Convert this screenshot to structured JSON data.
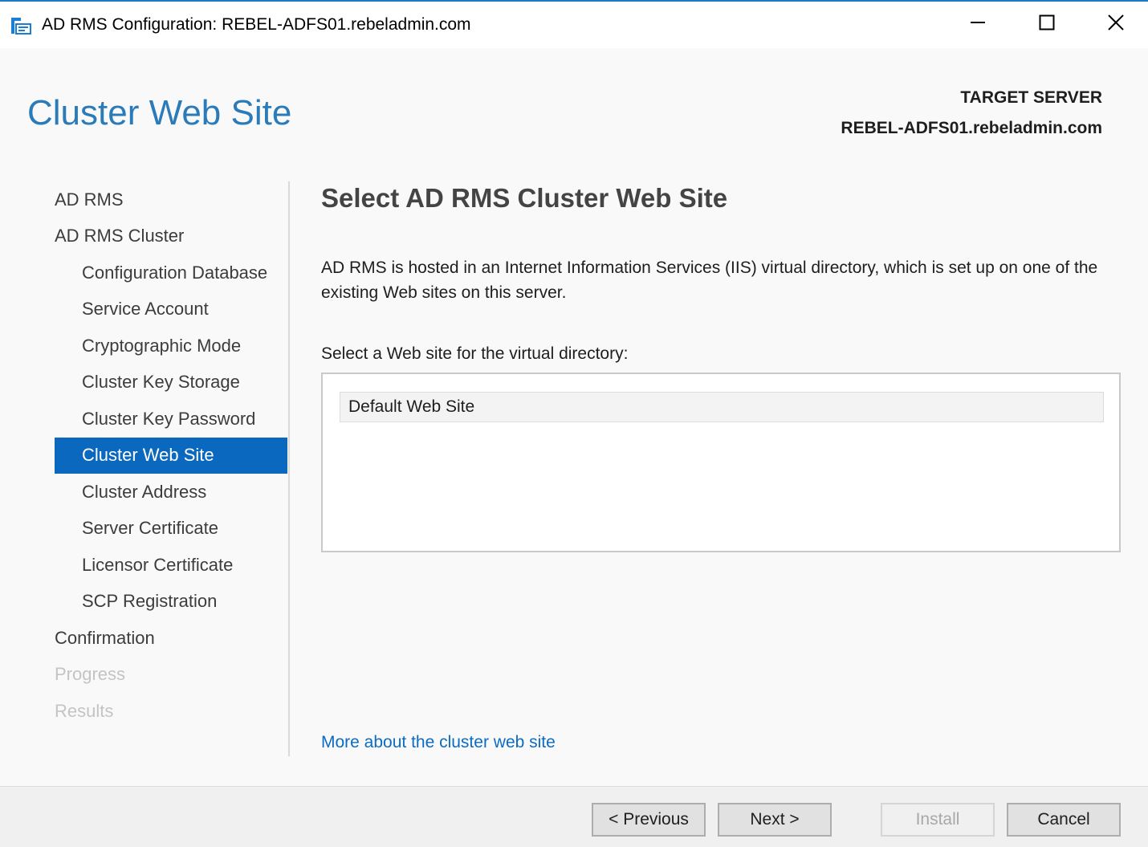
{
  "window": {
    "title": "AD RMS Configuration: REBEL-ADFS01.rebeladmin.com",
    "controls": [
      "minimize-icon",
      "maximize-icon",
      "close-icon"
    ]
  },
  "header": {
    "page_title": "Cluster Web Site",
    "target_label": "TARGET SERVER",
    "target_value": "REBEL-ADFS01.rebeladmin.com"
  },
  "nav": {
    "items": [
      {
        "label": "AD RMS",
        "level": 0,
        "state": "normal"
      },
      {
        "label": "AD RMS Cluster",
        "level": 0,
        "state": "normal"
      },
      {
        "label": "Configuration Database",
        "level": 1,
        "state": "normal"
      },
      {
        "label": "Service Account",
        "level": 1,
        "state": "normal"
      },
      {
        "label": "Cryptographic Mode",
        "level": 1,
        "state": "normal"
      },
      {
        "label": "Cluster Key Storage",
        "level": 1,
        "state": "normal"
      },
      {
        "label": "Cluster Key Password",
        "level": 1,
        "state": "normal"
      },
      {
        "label": "Cluster Web Site",
        "level": 1,
        "state": "selected"
      },
      {
        "label": "Cluster Address",
        "level": 1,
        "state": "normal"
      },
      {
        "label": "Server Certificate",
        "level": 1,
        "state": "normal"
      },
      {
        "label": "Licensor Certificate",
        "level": 1,
        "state": "normal"
      },
      {
        "label": "SCP Registration",
        "level": 1,
        "state": "normal"
      },
      {
        "label": "Confirmation",
        "level": 0,
        "state": "normal"
      },
      {
        "label": "Progress",
        "level": 0,
        "state": "disabled"
      },
      {
        "label": "Results",
        "level": 0,
        "state": "disabled"
      }
    ]
  },
  "main": {
    "section_title": "Select AD RMS Cluster Web Site",
    "description": "AD RMS is hosted in an Internet Information Services (IIS) virtual directory, which is set up on one of the existing Web sites on this server.",
    "select_label": "Select a Web site for the virtual directory:",
    "websites": [
      "Default Web Site"
    ],
    "more_link": "More about the cluster web site"
  },
  "footer": {
    "previous_label": "< Previous",
    "next_label": "Next >",
    "install_label": "Install",
    "cancel_label": "Cancel"
  },
  "colors": {
    "accent": "#0a68bf",
    "title": "#2b7bb9",
    "link": "#0a6cc4",
    "disabled": "#c4c4c4"
  }
}
